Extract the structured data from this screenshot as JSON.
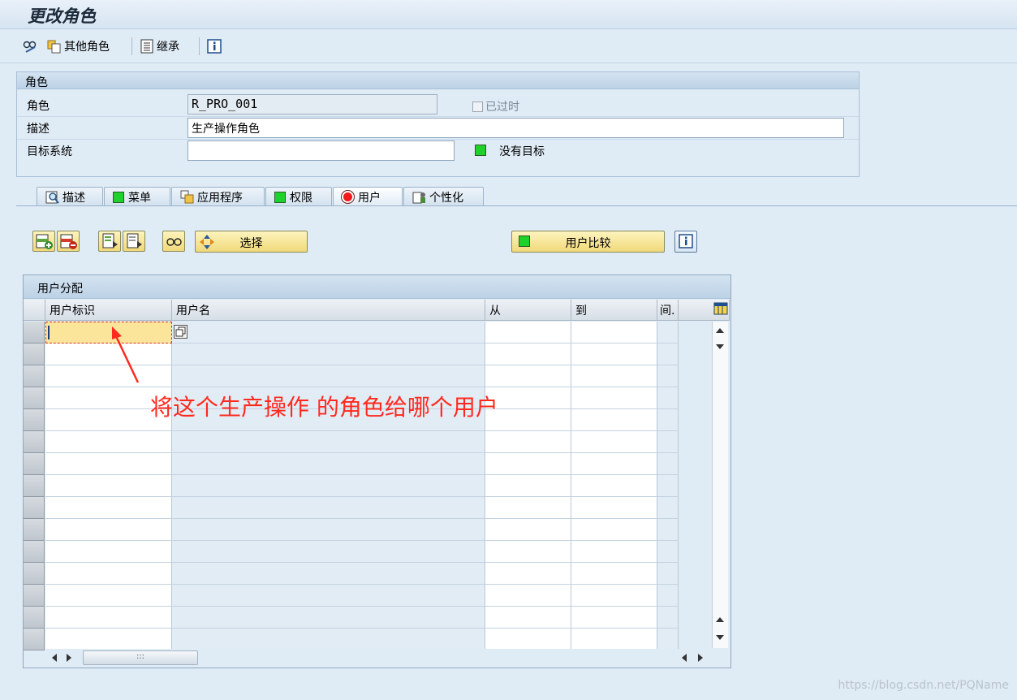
{
  "window": {
    "title": "更改角色"
  },
  "toolbar": {
    "other_role": "其他角色",
    "inherit": "继承"
  },
  "role_group": {
    "title": "角色",
    "role_label": "角色",
    "role_value": "R_PRO_001",
    "expired_label": "已过时",
    "desc_label": "描述",
    "desc_value": "生产操作角色",
    "target_label": "目标系统",
    "target_value": "",
    "no_target": "没有目标"
  },
  "tabs": [
    {
      "label": "描述",
      "icon": "magnifier-icon"
    },
    {
      "label": "菜单",
      "icon": "green-led-icon"
    },
    {
      "label": "应用程序",
      "icon": "app-icon"
    },
    {
      "label": "权限",
      "icon": "green-led-icon"
    },
    {
      "label": "用户",
      "icon": "red-led-icon"
    },
    {
      "label": "个性化",
      "icon": "personal-icon"
    }
  ],
  "actions": {
    "select": "选择",
    "user_compare": "用户比较"
  },
  "table": {
    "title": "用户分配",
    "columns": [
      "用户标识",
      "用户名",
      "从",
      "到",
      "间."
    ],
    "rows": 15
  },
  "annotation": "将这个生产操作 的角色给哪个用户",
  "watermark": "https://blog.csdn.net/PQName",
  "colors": {
    "accent_green": "#1fd12b",
    "annot_red": "#ff2a1f"
  }
}
